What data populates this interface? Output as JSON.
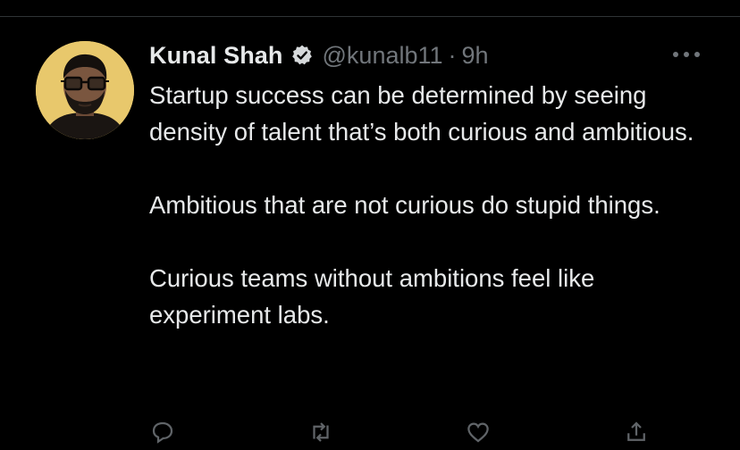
{
  "tweet": {
    "author_name": "Kunal Shah",
    "handle": "@kunalb11",
    "separator": "·",
    "timestamp": "9h",
    "paragraphs": [
      "Startup success can be determined by seeing density of talent that’s both curious and ambitious.",
      "Ambitious that are not curious do stupid things.",
      "Curious teams without ambitions feel like experiment labs."
    ]
  },
  "icons": {
    "verified": "verified-badge-icon",
    "more": "more-dots-icon",
    "actions": [
      "reply-icon",
      "retweet-icon",
      "like-icon",
      "share-icon"
    ]
  },
  "colors": {
    "background": "#000000",
    "text": "#e7e9ea",
    "secondary": "#71767b",
    "avatar_bg": "#e7c96f"
  }
}
